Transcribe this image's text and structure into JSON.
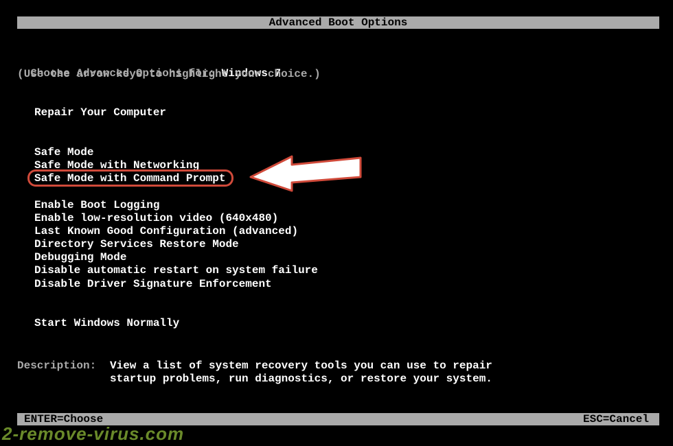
{
  "title": "Advanced Boot Options",
  "prompt": {
    "prefix": "Choose Advanced Options for: ",
    "os": "Windows 7"
  },
  "hint": "(Use the arrow keys to highlight your choice.)",
  "menu": {
    "repair": "Repair Your Computer",
    "safe_mode": "Safe Mode",
    "safe_mode_net": "Safe Mode with Networking",
    "safe_mode_cmd": "Safe Mode with Command Prompt",
    "boot_logging": "Enable Boot Logging",
    "low_res": "Enable low-resolution video (640x480)",
    "last_known": "Last Known Good Configuration (advanced)",
    "ds_restore": "Directory Services Restore Mode",
    "debugging": "Debugging Mode",
    "disable_restart": "Disable automatic restart on system failure",
    "disable_sig": "Disable Driver Signature Enforcement",
    "start_normal": "Start Windows Normally"
  },
  "description": {
    "label": "Description:",
    "line1": "View a list of system recovery tools you can use to repair",
    "line2": "startup problems, run diagnostics, or restore your system."
  },
  "footer": {
    "enter": "ENTER=Choose",
    "esc": "ESC=Cancel"
  },
  "watermark": "2-remove-virus.com",
  "colors": {
    "highlight_border": "#d04a3a"
  }
}
